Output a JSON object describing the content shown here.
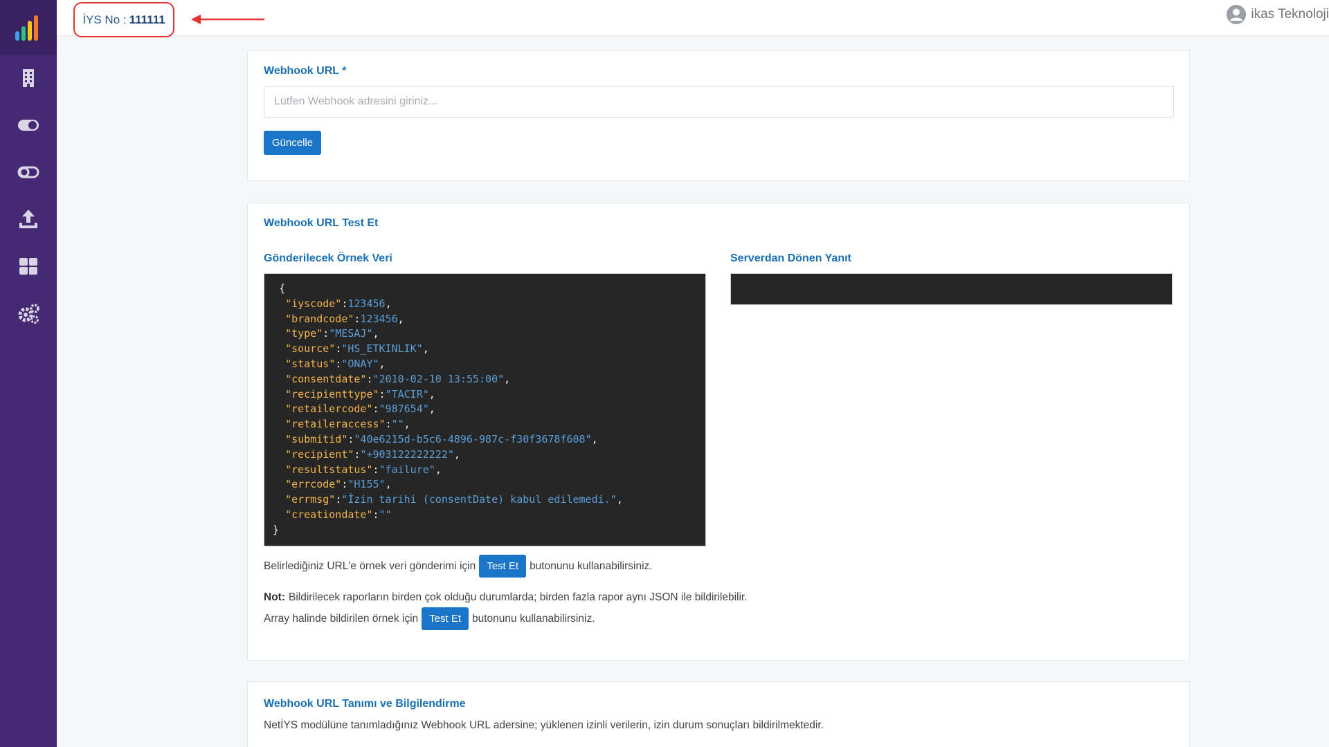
{
  "sidebar": {
    "logo": "bar-chart-logo",
    "items": [
      {
        "icon": "building-icon"
      },
      {
        "icon": "toggle-on-icon"
      },
      {
        "icon": "toggle-off-icon"
      },
      {
        "icon": "upload-icon"
      },
      {
        "icon": "grid-icon"
      },
      {
        "icon": "settings-icon"
      }
    ]
  },
  "header": {
    "iys_label": "İYS No :",
    "iys_number": "111111",
    "user_name": "ikas Teknoloji"
  },
  "webhook": {
    "label": "Webhook URL *",
    "placeholder": "Lütfen Webhook adresini giriniz...",
    "update_button": "Güncelle"
  },
  "test": {
    "title": "Webhook URL Test Et",
    "sample_label": "Gönderilecek Örnek Veri",
    "response_label": "Serverdan Dönen Yanıt",
    "sample_json": [
      {
        "key": "\"iyscode\"",
        "value": "123456"
      },
      {
        "key": "\"brandcode\"",
        "value": "123456"
      },
      {
        "key": "\"type\"",
        "value": "\"MESAJ\""
      },
      {
        "key": "\"source\"",
        "value": "\"HS_ETKINLIK\""
      },
      {
        "key": "\"status\"",
        "value": "\"ONAY\""
      },
      {
        "key": "\"consentdate\"",
        "value": "\"2010-02-10 13:55:00\""
      },
      {
        "key": "\"recipienttype\"",
        "value": "\"TACIR\""
      },
      {
        "key": "\"retailercode\"",
        "value": "\"987654\""
      },
      {
        "key": "\"retaileraccess\"",
        "value": "\"\""
      },
      {
        "key": "\"submitid\"",
        "value": "\"40e6215d-b5c6-4896-987c-f30f3678f608\""
      },
      {
        "key": "\"recipient\"",
        "value": "\"+903122222222\""
      },
      {
        "key": "\"resultstatus\"",
        "value": "\"failure\""
      },
      {
        "key": "\"errcode\"",
        "value": "\"H155\""
      },
      {
        "key": "\"errmsg\"",
        "value": "\"İzin tarihi (consentDate) kabul edilemedi.\""
      },
      {
        "key": "\"creationdate\"",
        "value": "\"\""
      }
    ],
    "line1_before": "Belirlediğiniz URL'e örnek veri gönderimi için",
    "line1_button": "Test Et",
    "line1_after": "butonunu kullanabilirsiniz.",
    "note_bold": "Not:",
    "note_text": "Bildirilecek raporların birden çok olduğu durumlarda; birden fazla rapor aynı JSON ile bildirilebilir.",
    "line3_before": "Array halinde bildirilen örnek için",
    "line3_button": "Test Et",
    "line3_after": "butonunu kullanabilirsiniz."
  },
  "info": {
    "title": "Webhook URL Tanımı ve Bilgilendirme",
    "text": "NetİYS modülüne tanımladığınız Webhook URL adersine; yüklenen izinli verilerin, izin durum sonuçları bildirilmektedir."
  },
  "colors": {
    "sidebar": "#452a73",
    "accent": "#1a74c8",
    "highlight": "#e8322f",
    "code_bg": "#262626",
    "json_key": "#f2b44a",
    "json_value": "#5a9fd8"
  }
}
